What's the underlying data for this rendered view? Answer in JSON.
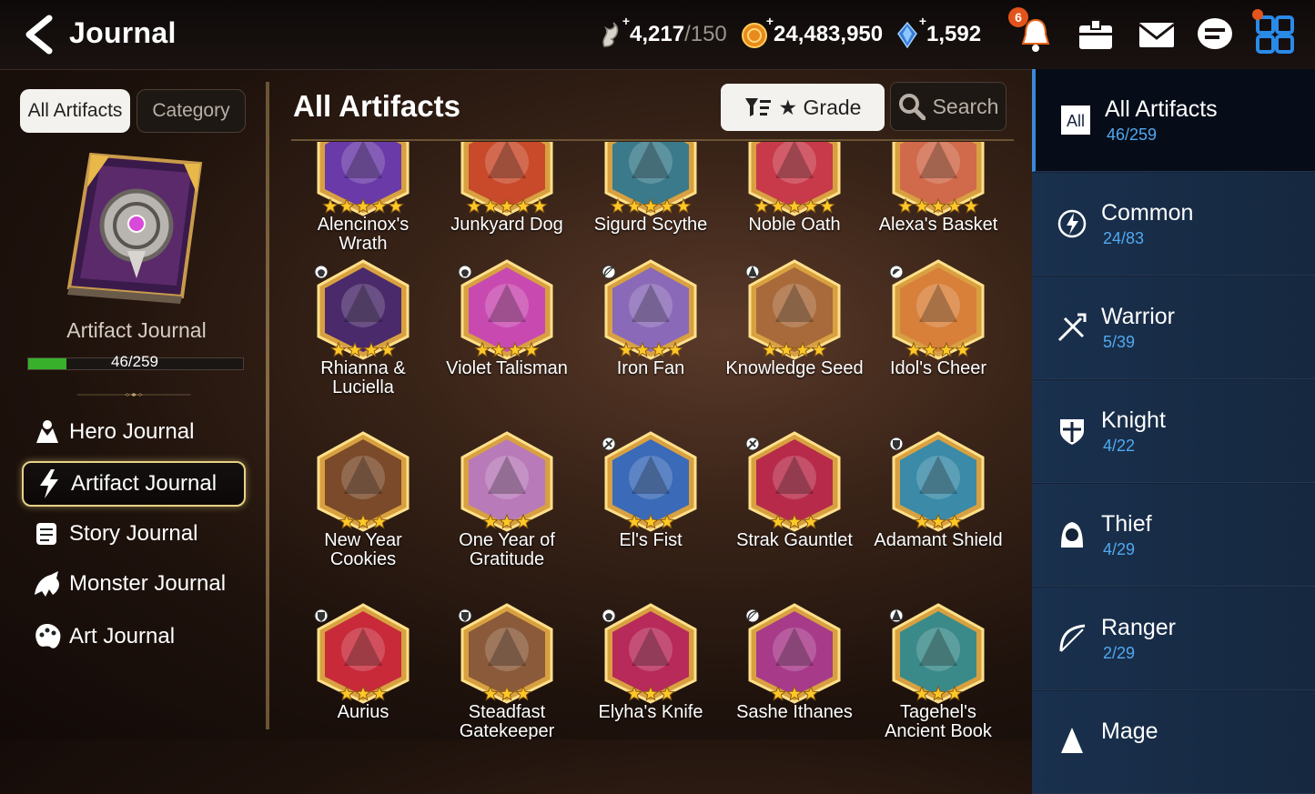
{
  "header": {
    "title": "Journal"
  },
  "resources": [
    {
      "icon": "stamina-icon",
      "value": "4,217",
      "max": "/150"
    },
    {
      "icon": "gold-icon",
      "value": "24,483,950",
      "max": ""
    },
    {
      "icon": "crystal-icon",
      "value": "1,592",
      "max": ""
    }
  ],
  "notifications": {
    "count": "6"
  },
  "left": {
    "tabs": [
      "All Artifacts",
      "Category"
    ],
    "journal_title": "Artifact Journal",
    "progress_text": "46/259",
    "progress_fraction": 0.178,
    "nav": [
      {
        "label": "Hero Journal",
        "icon": "hero-icon"
      },
      {
        "label": "Artifact Journal",
        "icon": "lightning-icon",
        "active": true
      },
      {
        "label": "Story Journal",
        "icon": "scroll-icon"
      },
      {
        "label": "Monster Journal",
        "icon": "monster-icon"
      },
      {
        "label": "Art Journal",
        "icon": "palette-icon"
      }
    ]
  },
  "center": {
    "title": "All Artifacts",
    "grade_label": "★ Grade",
    "search_label": "Search",
    "artifacts": [
      {
        "name": "Alencinox's\nWrath",
        "stars": 5,
        "cls": "none",
        "color": "#6a3aa8"
      },
      {
        "name": "Junkyard Dog",
        "stars": 5,
        "cls": "none",
        "color": "#c84a2a"
      },
      {
        "name": "Sigurd Scythe",
        "stars": 5,
        "cls": "none",
        "color": "#3a7a8a"
      },
      {
        "name": "Noble Oath",
        "stars": 5,
        "cls": "none",
        "color": "#c83a4a"
      },
      {
        "name": "Alexa's Basket",
        "stars": 5,
        "cls": "none",
        "color": "#d06a4a"
      },
      {
        "name": "Rhianna &\nLuciella",
        "stars": 4,
        "cls": "thief",
        "color": "#4a2a6a"
      },
      {
        "name": "Violet Talisman",
        "stars": 4,
        "cls": "thief",
        "color": "#c84ab0"
      },
      {
        "name": "Iron Fan",
        "stars": 4,
        "cls": "ranger",
        "color": "#8a6ab8"
      },
      {
        "name": "Knowledge Seed",
        "stars": 4,
        "cls": "mage",
        "color": "#a86a3a"
      },
      {
        "name": "Idol's Cheer",
        "stars": 4,
        "cls": "soul",
        "color": "#d8803a"
      },
      {
        "name": "New Year\nCookies",
        "stars": 3,
        "cls": "none",
        "color": "#7a4a2a"
      },
      {
        "name": "One Year of\nGratitude",
        "stars": 3,
        "cls": "none",
        "color": "#b87ab8"
      },
      {
        "name": "El's Fist",
        "stars": 3,
        "cls": "warrior",
        "color": "#3a6ab8"
      },
      {
        "name": "Strak Gauntlet",
        "stars": 3,
        "cls": "warrior",
        "color": "#b82a4a"
      },
      {
        "name": "Adamant Shield",
        "stars": 3,
        "cls": "knight",
        "color": "#3a8aa8"
      },
      {
        "name": "Aurius",
        "stars": 3,
        "cls": "knight",
        "color": "#c82a3a"
      },
      {
        "name": "Steadfast\nGatekeeper",
        "stars": 3,
        "cls": "knight",
        "color": "#8a5a3a"
      },
      {
        "name": "Elyha's Knife",
        "stars": 3,
        "cls": "thief",
        "color": "#b82a5a"
      },
      {
        "name": "Sashe Ithanes",
        "stars": 3,
        "cls": "ranger",
        "color": "#a83a8a"
      },
      {
        "name": "Tagehel's\nAncient Book",
        "stars": 3,
        "cls": "mage",
        "color": "#3a8a8a"
      }
    ]
  },
  "categories": [
    {
      "label": "All Artifacts",
      "count": "46/259",
      "icon": "all-icon",
      "icon_text": "All",
      "active": true
    },
    {
      "label": "Common",
      "count": "24/83",
      "icon": "common-icon"
    },
    {
      "label": "Warrior",
      "count": "5/39",
      "icon": "warrior-icon"
    },
    {
      "label": "Knight",
      "count": "4/22",
      "icon": "knight-icon"
    },
    {
      "label": "Thief",
      "count": "4/29",
      "icon": "thief-icon"
    },
    {
      "label": "Ranger",
      "count": "2/29",
      "icon": "ranger-icon"
    },
    {
      "label": "Mage",
      "count": "",
      "icon": "mage-icon"
    }
  ],
  "colors": {
    "accent_blue": "#52a8f0",
    "gold": "#e8b84a",
    "progress_green": "#38b02c",
    "badge_orange": "#e2541c"
  }
}
